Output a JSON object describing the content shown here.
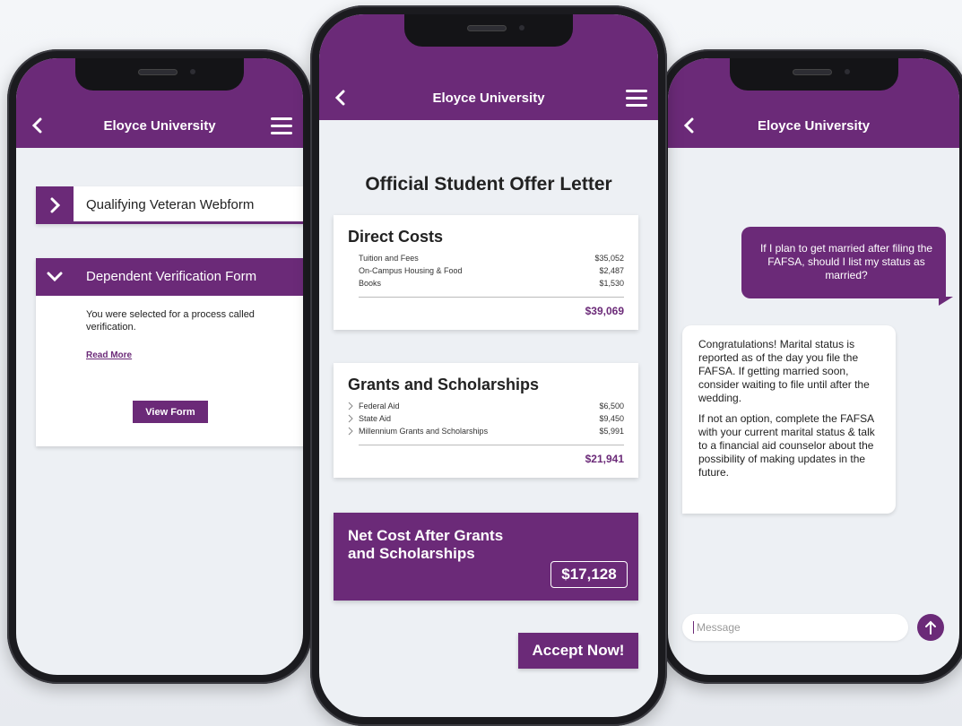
{
  "colors": {
    "brand": "#6b2a78",
    "background": "#edf0f4"
  },
  "phone_left": {
    "header": {
      "title": "Eloyce University",
      "back_icon": "chevron-left-icon",
      "menu_icon": "hamburger-menu-icon"
    },
    "veteran_form": {
      "label": "Qualifying Veteran Webform",
      "icon": "chevron-right-icon"
    },
    "dependent_form": {
      "label": "Dependent Verification Form",
      "icon": "chevron-down-icon",
      "description": "You were selected for a process called verification.",
      "read_more": "Read More",
      "view_form": "View Form"
    }
  },
  "phone_center": {
    "header": {
      "title": "Eloyce University",
      "back_icon": "chevron-left-icon",
      "menu_icon": "hamburger-menu-icon"
    },
    "page_title": "Official Student Offer Letter",
    "direct_costs": {
      "title": "Direct Costs",
      "rows": [
        {
          "label": "Tuition and Fees",
          "amount": "$35,052"
        },
        {
          "label": "On-Campus Housing & Food",
          "amount": "$2,487"
        },
        {
          "label": "Books",
          "amount": "$1,530"
        }
      ],
      "total": "$39,069"
    },
    "grants": {
      "title": "Grants and Scholarships",
      "rows": [
        {
          "label": "Federal Aid",
          "amount": "$6,500"
        },
        {
          "label": "State Aid",
          "amount": "$9,450"
        },
        {
          "label": "Millennium Grants and Scholarships",
          "amount": "$5,991"
        }
      ],
      "total": "$21,941"
    },
    "net_cost": {
      "label": "Net Cost After Grants and Scholarships",
      "amount": "$17,128"
    },
    "accept_button": "Accept Now!"
  },
  "phone_right": {
    "header": {
      "title": "Eloyce University",
      "back_icon": "chevron-left-icon"
    },
    "message_out": "If I plan to get married after filing the FAFSA, should I list my status as married?",
    "message_in_p1": "Congratulations!  Marital status is reported as of the day you file the FAFSA. If getting married soon, consider waiting to file until after the wedding.",
    "message_in_p2": "If not an option, complete the FAFSA with your current marital status & talk to a financial aid counselor about the possibility of making updates in the future.",
    "input_placeholder": "Message",
    "send_icon": "arrow-up-icon"
  }
}
